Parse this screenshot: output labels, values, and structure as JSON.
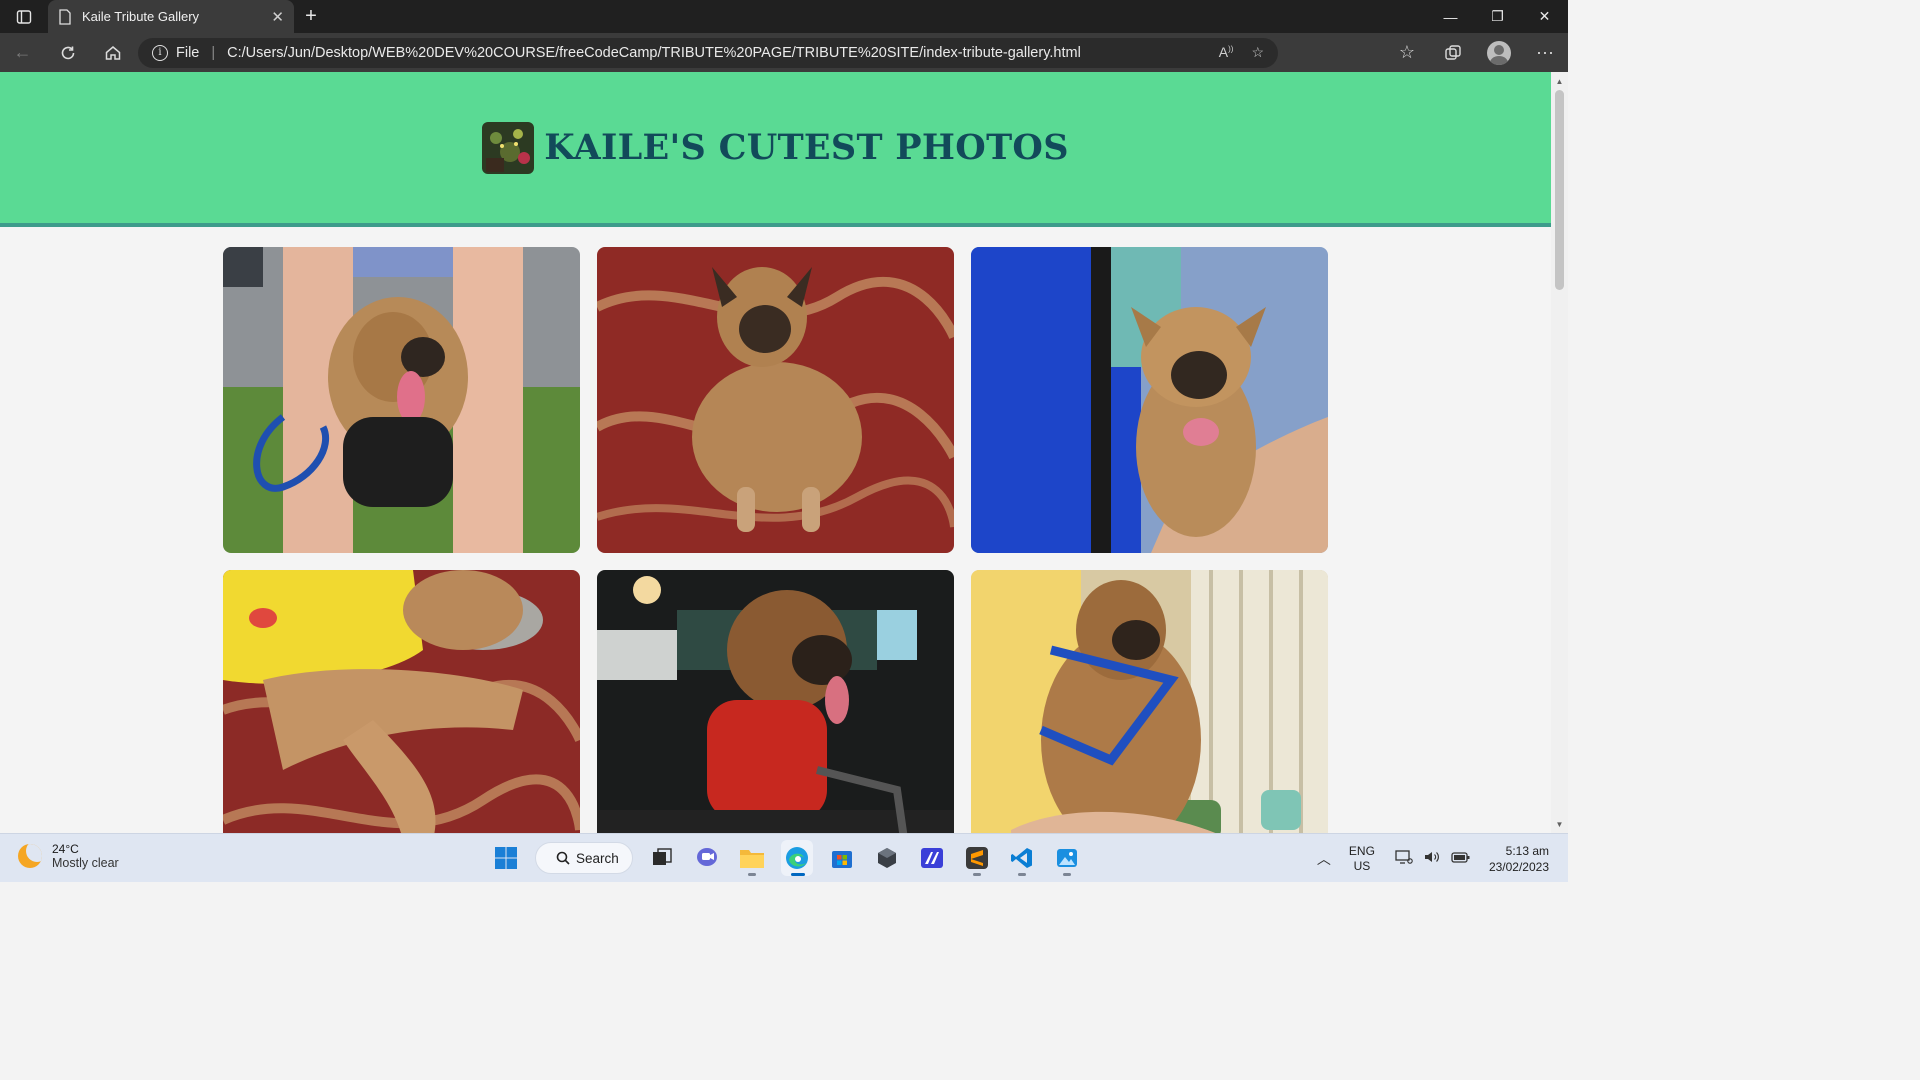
{
  "browser": {
    "tab_title": "Kaile Tribute Gallery",
    "address_prefix": "File",
    "url": "C:/Users/Jun/Desktop/WEB%20DEV%20COURSE/freeCodeCamp/TRIBUTE%20PAGE/TRIBUTE%20SITE/index-tribute-gallery.html",
    "icons": [
      "sidebar-icon",
      "page-icon",
      "close-icon",
      "plus-icon",
      "minimize-icon",
      "restore-icon",
      "close-window-icon",
      "back-icon",
      "refresh-icon",
      "home-icon",
      "info-icon",
      "read-aloud-icon",
      "add-favorite-icon",
      "favorites-icon",
      "collections-icon",
      "profile-icon",
      "more-icon"
    ]
  },
  "page": {
    "title": "KAILE'S CUTEST PHOTOS",
    "header_color": "#5ada94",
    "header_border_color": "#3d9b8b",
    "title_color": "#124a5a",
    "photos": [
      {
        "subject": "dog-with-blue-leash-on-grass"
      },
      {
        "subject": "puppy-on-red-floral-cloth"
      },
      {
        "subject": "dog-held-against-blue-jacket"
      },
      {
        "subject": "dog-in-yellow-shirt-lying"
      },
      {
        "subject": "dog-in-red-shirt-at-night"
      },
      {
        "subject": "dog-in-blue-harness-held"
      }
    ]
  },
  "taskbar": {
    "weather_temp": "24°C",
    "weather_desc": "Mostly clear",
    "search_label": "Search",
    "lang_line1": "ENG",
    "lang_line2": "US",
    "time": "5:13 am",
    "date": "23/02/2023"
  }
}
